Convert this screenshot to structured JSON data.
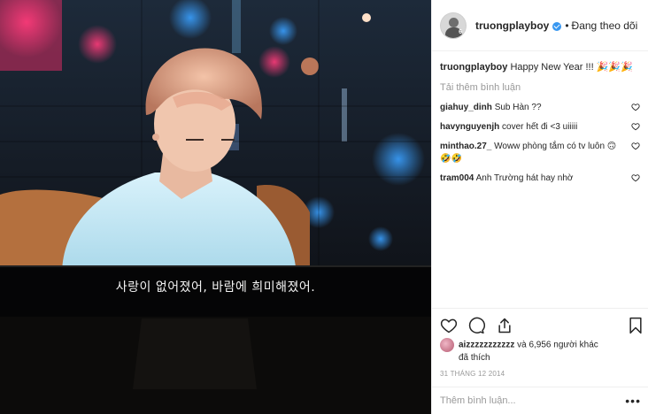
{
  "post": {
    "subtitle": "사랑이 없어졌어, 바람에 희미해졌어."
  },
  "header": {
    "username": "truongplayboy",
    "separator": "•",
    "follow_state": "Đang theo dõi"
  },
  "caption": {
    "username": "truongplayboy",
    "text": "Happy New Year !!!"
  },
  "load_more": "Tải thêm bình luận",
  "comments": [
    {
      "username": "giahuy_dinh",
      "text": "Sub Hàn ??"
    },
    {
      "username": "havynguyenjh",
      "text": "cover hết đi <3 uiiiii"
    },
    {
      "username": "minthao.27_",
      "text": "Woww phòng tắm có tv luôn 🙃🤣🤣"
    },
    {
      "username": "tram004",
      "text": "Anh Trường hát hay nhờ"
    }
  ],
  "likes": {
    "username": "aizzzzzzzzzzz",
    "text_a": "và 6,956 người khác",
    "text_b": "đã thích"
  },
  "date": "31 THÁNG 12 2014",
  "add_comment": {
    "placeholder": "Thêm bình luận..."
  },
  "colors": {
    "verified": "#3897f0",
    "link_grey": "#999999",
    "text": "#262626"
  },
  "icons": [
    "heart-icon",
    "comment-icon",
    "share-icon",
    "bookmark-icon",
    "verified-icon",
    "more-icon"
  ]
}
